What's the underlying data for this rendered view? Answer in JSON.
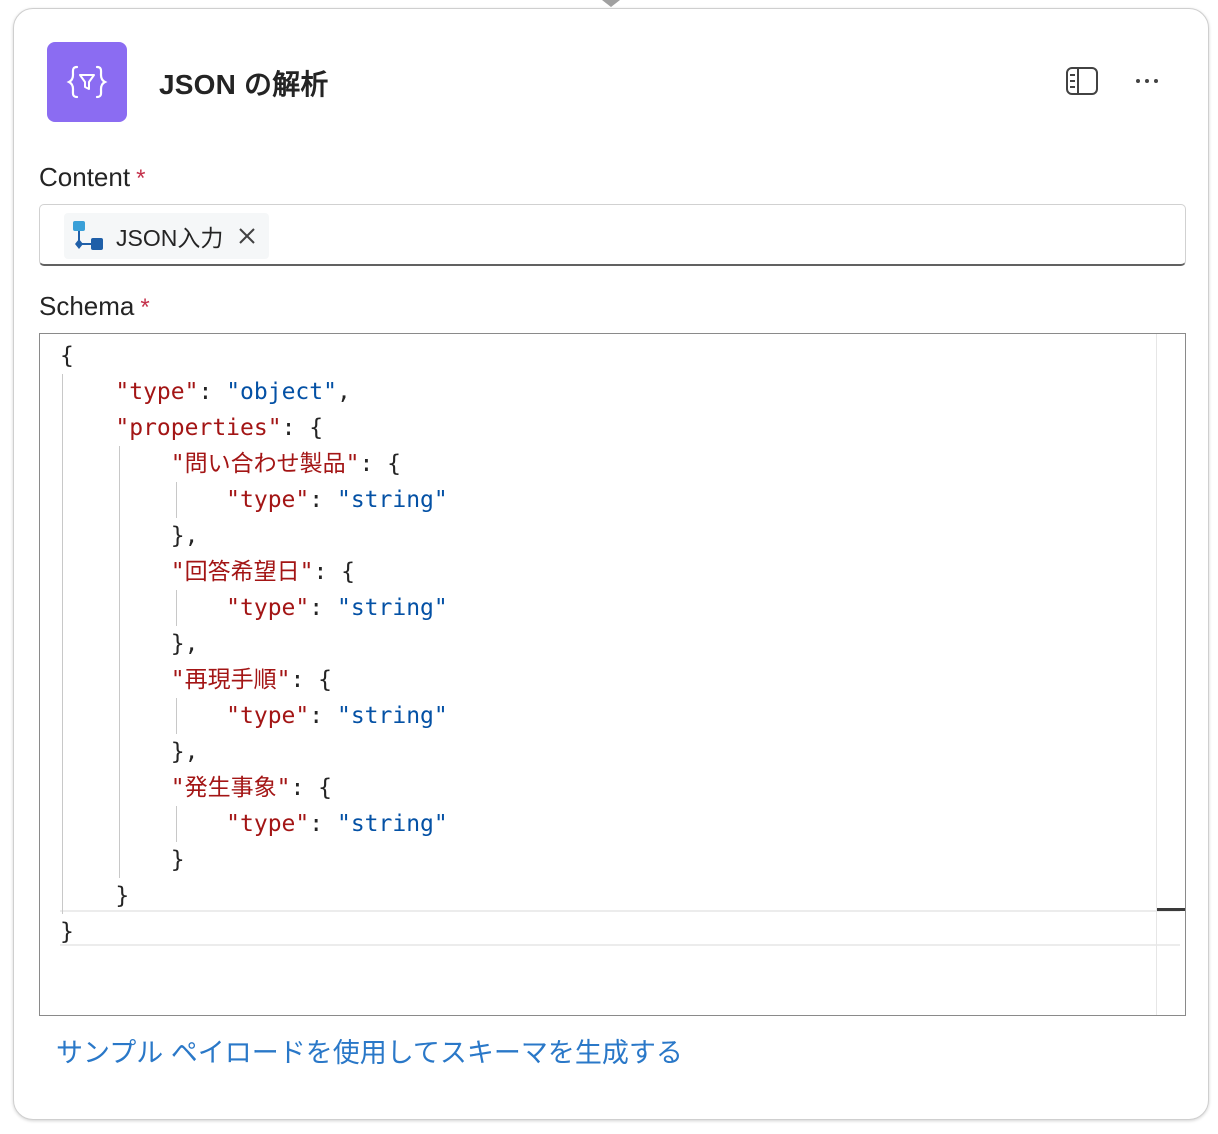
{
  "action": {
    "title": "JSON の解析",
    "icon": "curly-braces-filter-icon",
    "icon_color": "#8b6cf2"
  },
  "content": {
    "label": "Content",
    "required_mark": "*",
    "token_label": "JSON入力"
  },
  "schema": {
    "label": "Schema",
    "required_mark": "*",
    "lines": [
      [
        {
          "t": "{",
          "c": "p"
        }
      ],
      [
        {
          "t": "    ",
          "c": "p"
        },
        {
          "t": "\"type\"",
          "c": "k"
        },
        {
          "t": ": ",
          "c": "p"
        },
        {
          "t": "\"object\"",
          "c": "s"
        },
        {
          "t": ",",
          "c": "p"
        }
      ],
      [
        {
          "t": "    ",
          "c": "p"
        },
        {
          "t": "\"properties\"",
          "c": "k"
        },
        {
          "t": ": {",
          "c": "p"
        }
      ],
      [
        {
          "t": "        ",
          "c": "p"
        },
        {
          "t": "\"問い合わせ製品\"",
          "c": "k"
        },
        {
          "t": ": {",
          "c": "p"
        }
      ],
      [
        {
          "t": "            ",
          "c": "p"
        },
        {
          "t": "\"type\"",
          "c": "k"
        },
        {
          "t": ": ",
          "c": "p"
        },
        {
          "t": "\"string\"",
          "c": "s"
        }
      ],
      [
        {
          "t": "        },",
          "c": "p"
        }
      ],
      [
        {
          "t": "        ",
          "c": "p"
        },
        {
          "t": "\"回答希望日\"",
          "c": "k"
        },
        {
          "t": ": {",
          "c": "p"
        }
      ],
      [
        {
          "t": "            ",
          "c": "p"
        },
        {
          "t": "\"type\"",
          "c": "k"
        },
        {
          "t": ": ",
          "c": "p"
        },
        {
          "t": "\"string\"",
          "c": "s"
        }
      ],
      [
        {
          "t": "        },",
          "c": "p"
        }
      ],
      [
        {
          "t": "        ",
          "c": "p"
        },
        {
          "t": "\"再現手順\"",
          "c": "k"
        },
        {
          "t": ": {",
          "c": "p"
        }
      ],
      [
        {
          "t": "            ",
          "c": "p"
        },
        {
          "t": "\"type\"",
          "c": "k"
        },
        {
          "t": ": ",
          "c": "p"
        },
        {
          "t": "\"string\"",
          "c": "s"
        }
      ],
      [
        {
          "t": "        },",
          "c": "p"
        }
      ],
      [
        {
          "t": "        ",
          "c": "p"
        },
        {
          "t": "\"発生事象\"",
          "c": "k"
        },
        {
          "t": ": {",
          "c": "p"
        }
      ],
      [
        {
          "t": "            ",
          "c": "p"
        },
        {
          "t": "\"type\"",
          "c": "k"
        },
        {
          "t": ": ",
          "c": "p"
        },
        {
          "t": "\"string\"",
          "c": "s"
        }
      ],
      [
        {
          "t": "        }",
          "c": "p"
        }
      ],
      [
        {
          "t": "    }",
          "c": "p"
        }
      ],
      [
        {
          "t": "}",
          "c": "p"
        }
      ]
    ]
  },
  "generate_link": "サンプル ペイロードを使用してスキーマを生成する"
}
